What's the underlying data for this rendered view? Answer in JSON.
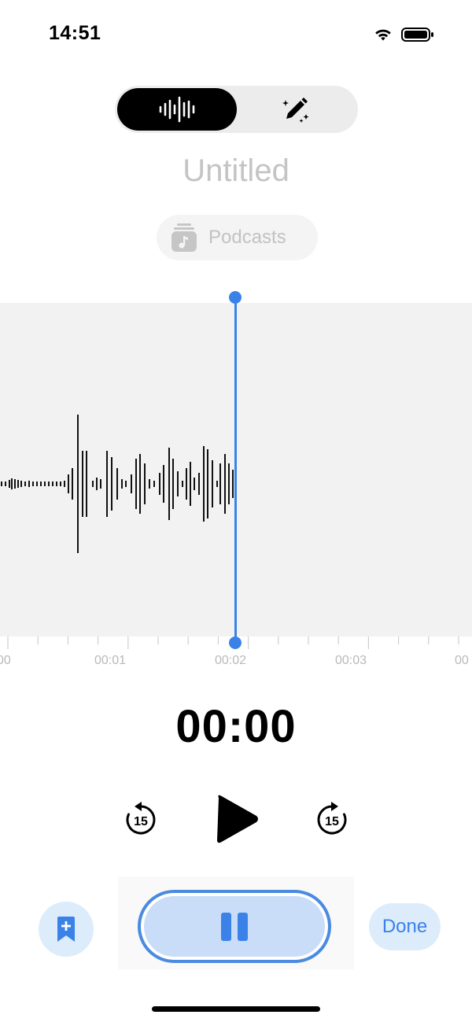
{
  "status_bar": {
    "time": "14:51",
    "icons": [
      "wifi-icon",
      "battery-icon"
    ]
  },
  "mode_toggle": {
    "segments": [
      "waveform-icon",
      "magic-pencil-icon"
    ],
    "selected": 0
  },
  "recording": {
    "title": "Untitled",
    "folder": "Podcasts"
  },
  "waveform": {
    "time_labels": [
      "00",
      "00:01",
      "00:02",
      "00:03",
      "00"
    ],
    "playhead": "00:02"
  },
  "playback": {
    "current_time": "00:00",
    "skip_back_seconds": "15",
    "skip_forward_seconds": "15"
  },
  "actions": {
    "done_label": "Done"
  },
  "colors": {
    "accent": "#3a82e8",
    "accent_light": "#dcecfb",
    "waveform_bg": "#f2f2f2"
  }
}
